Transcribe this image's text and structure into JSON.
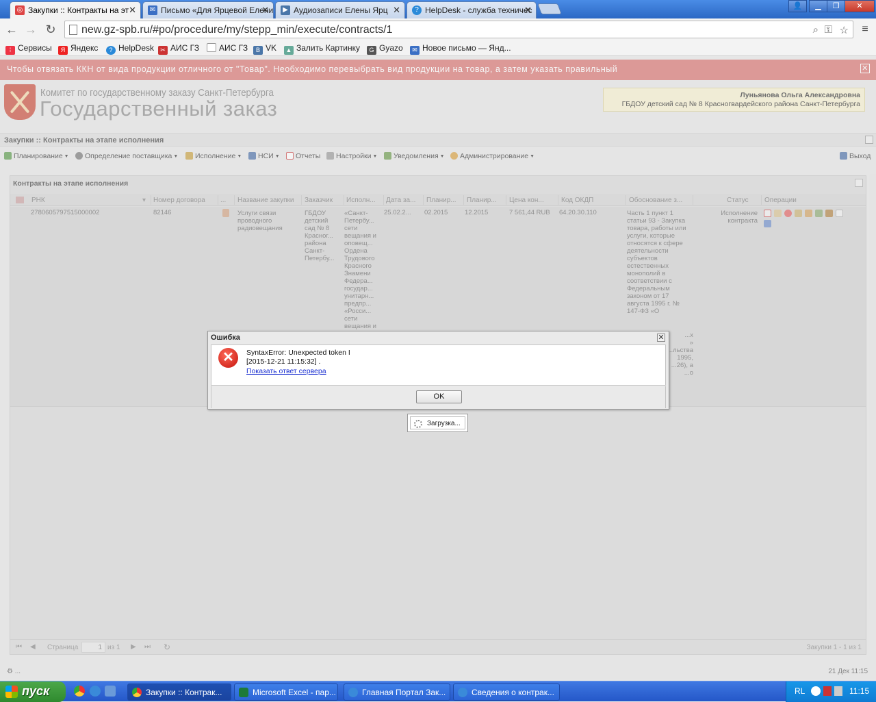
{
  "browser": {
    "tabs": [
      {
        "title": "Закупки :: Контракты на эт",
        "icon": "globe-icon",
        "icon_color": "#d44"
      },
      {
        "title": "Письмо «Для Ярцевой Елени",
        "icon": "mail-icon",
        "icon_color": "#3b6fc4"
      },
      {
        "title": "Аудиозаписи Елены Ярц",
        "icon": "play-icon",
        "icon_color": "#4a76a8"
      },
      {
        "title": "HelpDesk - служба техничес",
        "icon": "help-icon",
        "icon_color": "#2a8ad9"
      }
    ],
    "url": "new.gz-spb.ru/#po/procedure/my/stepp_min/execute/contracts/1",
    "bookmarks": [
      {
        "label": "Сервисы",
        "icon": "apps-icon",
        "color": "#e34"
      },
      {
        "label": "Яндекс",
        "icon": "yandex-icon",
        "color": "#e22"
      },
      {
        "label": "HelpDesk",
        "icon": "help-icon",
        "color": "#2a8ad9"
      },
      {
        "label": "АИС ГЗ",
        "icon": "tools-icon",
        "color": "#c33"
      },
      {
        "label": "АИС ГЗ",
        "icon": "page-icon",
        "color": "#999"
      },
      {
        "label": "VK",
        "icon": "vk-icon",
        "color": "#4a76a8"
      },
      {
        "label": "Залить Картинку",
        "icon": "image-icon",
        "color": "#6a9"
      },
      {
        "label": "Gyazo",
        "icon": "gyazo-icon",
        "color": "#555"
      },
      {
        "label": "Новое письмо — Янд...",
        "icon": "mail-icon",
        "color": "#3b6fc4"
      }
    ]
  },
  "notice": {
    "text": "Чтобы отвязать ККН от вида продукции отличного от \"Товар\". Необходимо перевыбрать вид продукции на товар, а затем указать правильный",
    "close": "✕"
  },
  "header": {
    "line1": "Комитет по государственному заказу Санкт-Петербурга",
    "line2": "Государственный заказ",
    "user_name": "Луньянова Ольга Александровна",
    "organization": "ГБДОУ детский сад № 8 Красногвардейского района Санкт-Петербурга"
  },
  "breadcrumb": "Закупки :: Контракты на этапе исполнения",
  "menu": [
    {
      "label": "Планирование",
      "icon": "planning-icon",
      "color": "#5a9a4a"
    },
    {
      "label": "Определение поставщика",
      "icon": "supplier-icon",
      "color": "#777"
    },
    {
      "label": "Исполнение",
      "icon": "execution-icon",
      "color": "#c8a040"
    },
    {
      "label": "НСИ",
      "icon": "nsi-icon",
      "color": "#4a6fa8"
    },
    {
      "label": "Отчеты",
      "icon": "reports-icon",
      "color": "#c44"
    },
    {
      "label": "Настройки",
      "icon": "settings-icon",
      "color": "#777"
    },
    {
      "label": "Уведомления",
      "icon": "notifications-icon",
      "color": "#6a9a4a"
    },
    {
      "label": "Администрирование",
      "icon": "admin-icon",
      "color": "#d9a040"
    }
  ],
  "logout": "Выход",
  "panel": {
    "title": "Контракты на этапе исполнения",
    "columns": [
      "РНК",
      "Номер договора",
      "...",
      "Название закупки",
      "Заказчик",
      "Исполн...",
      "Дата за...",
      "Планир...",
      "Планир...",
      "Цена кон...",
      "Код ОКДП",
      "Обоснование з...",
      "Статус",
      "Операции"
    ],
    "row": {
      "rnk": "2780605797515000002",
      "contract_no": "82146",
      "name": "Услуги связи проводного радиовещания",
      "customer": "ГБДОУ детский сад № 8 Красног... района Санкт-Петербу...",
      "executor": "«Санкт-Петербу... сети вещания и оповещ... Ордена Трудового Красного Знамени Федера... государ... унитарн... предпр... «Росси... сети вещания и",
      "date": "25.02.2...",
      "plan1": "02.2015",
      "plan2": "12.2015",
      "price": "7 561,44 RUB",
      "okdp": "64.20.30.110",
      "justification": "Часть 1 пункт 1 статьи 93 - Закупка товара, работы или услуги, которые относятся к сфере деятельности субъектов естественных монополий в соответствии с Федеральным законом от 17 августа 1995 г. № 147-ФЗ «О",
      "justification_tail": [
        "...х",
        "»",
        "",
        "...льства",
        "",
        "1995,",
        "...26), а",
        "",
        "...о"
      ],
      "status": "Исполнение контракта"
    },
    "pager": {
      "page_label": "Страница",
      "page": "1",
      "of": "из 1",
      "summary": "Закупки 1 - 1 из 1"
    }
  },
  "status_left": "⚙ ...",
  "status_right": "21 Дек 11:15",
  "dialog": {
    "title": "Ошибка",
    "message_line1": "SyntaxError: Unexpected token I",
    "message_line2": "[2015-12-21 11:15:32] .",
    "link": "Показать ответ сервера",
    "ok": "OK"
  },
  "loading": "Загрузка...",
  "taskbar": {
    "start": "пуск",
    "tasks": [
      {
        "label": "Закупки :: Контрак...",
        "icon": "chrome-icon",
        "color": "#e44"
      },
      {
        "label": "Microsoft Excel - пар...",
        "icon": "excel-icon",
        "color": "#1d7a3a"
      },
      {
        "label": "Главная Портал Зак...",
        "icon": "ie-icon",
        "color": "#3a8ad9"
      },
      {
        "label": "Сведения о контрак...",
        "icon": "ie-icon",
        "color": "#3a8ad9"
      }
    ],
    "lang": "RL",
    "clock": "11:15"
  }
}
